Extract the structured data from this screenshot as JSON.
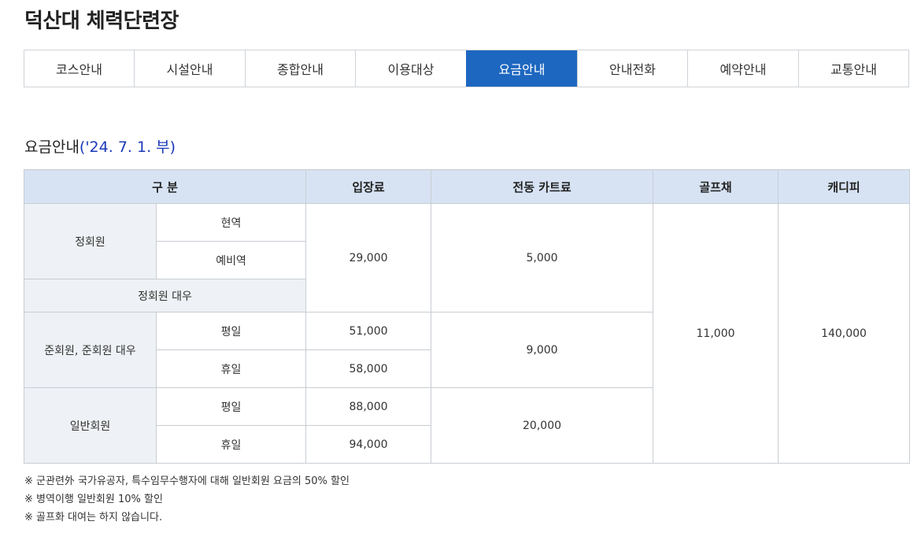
{
  "page": {
    "title": "덕산대 체력단련장"
  },
  "tabs": [
    {
      "label": "코스안내",
      "active": false
    },
    {
      "label": "시설안내",
      "active": false
    },
    {
      "label": "종합안내",
      "active": false
    },
    {
      "label": "이용대상",
      "active": false
    },
    {
      "label": "요금안내",
      "active": true
    },
    {
      "label": "안내전화",
      "active": false
    },
    {
      "label": "예약안내",
      "active": false
    },
    {
      "label": "교통안내",
      "active": false
    }
  ],
  "section": {
    "title": "요금안내",
    "date": "('24. 7. 1. 부)"
  },
  "table": {
    "headers": {
      "category": "구 분",
      "entry_fee": "입장료",
      "cart_fee": "전동 카트료",
      "golf_bag": "골프채",
      "caddie_fee": "캐디피"
    },
    "regular": {
      "label": "정회원",
      "active_duty": "현역",
      "reserve": "예비역",
      "treated": "정회원 대우",
      "entry_fee": "29,000",
      "cart_fee": "5,000"
    },
    "associate": {
      "label": "준회원, 준회원 대우",
      "weekday": "평일",
      "holiday": "휴일",
      "entry_weekday": "51,000",
      "entry_holiday": "58,000",
      "cart_fee": "9,000"
    },
    "general": {
      "label": "일반회원",
      "weekday": "평일",
      "holiday": "휴일",
      "entry_weekday": "88,000",
      "entry_holiday": "94,000",
      "cart_fee": "20,000"
    },
    "golf_bag_fee": "11,000",
    "caddie_fee": "140,000"
  },
  "notes": [
    "※ 군관련外 국가유공자, 특수임무수행자에 대해 일반회원 요금의 50% 할인",
    "※ 병역이행 일반회원 10% 할인",
    "※ 골프화 대여는 하지 않습니다."
  ],
  "colors": {
    "accent": "#1d67c0",
    "header_bg": "#d7e3f3",
    "category_bg": "#eef1f5",
    "date_text": "#1a39b8"
  }
}
